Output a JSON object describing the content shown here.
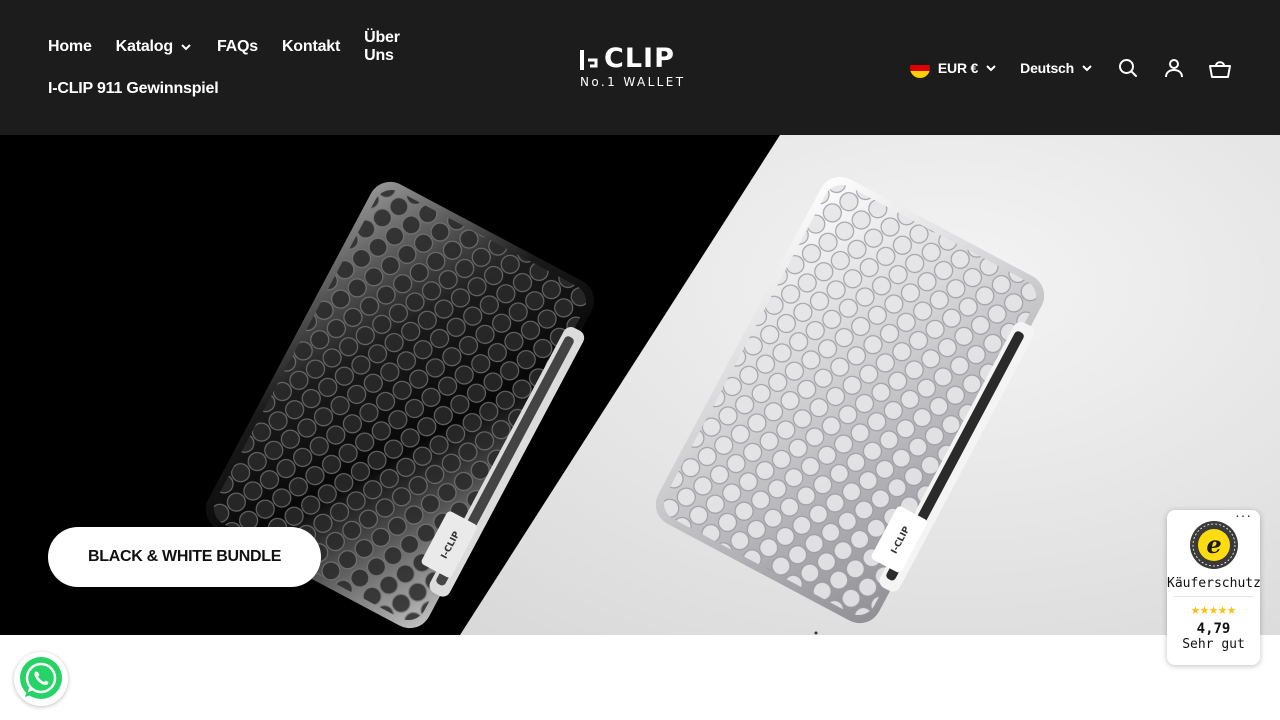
{
  "header": {
    "nav": {
      "row1": [
        {
          "label": "Home"
        },
        {
          "label": "Katalog",
          "has_dropdown": true
        },
        {
          "label": "FAQs"
        },
        {
          "label": "Kontakt"
        },
        {
          "label": "Über Uns"
        }
      ],
      "row2": [
        {
          "label": "I-CLIP 911 Gewinnspiel"
        }
      ]
    },
    "logo": {
      "main": "I-CLIP",
      "sub": "No.1 WALLET"
    },
    "currency": {
      "label": "EUR €",
      "flag": "germany-flag"
    },
    "language": {
      "label": "Deutsch"
    },
    "icons": [
      "search-icon",
      "account-icon",
      "cart-icon"
    ]
  },
  "hero": {
    "button_label": "BLACK & WHITE BUNDLE",
    "product_mark": "I-CLIP"
  },
  "trusted_shops": {
    "label": "Käuferschutz",
    "stars": "★★★★★",
    "score": "4,79",
    "grade": "Sehr gut",
    "more": "···",
    "seal_letter": "e"
  },
  "colors": {
    "header_bg": "#1c1c1d",
    "star": "#ffc107",
    "whatsapp": "#25d366"
  }
}
